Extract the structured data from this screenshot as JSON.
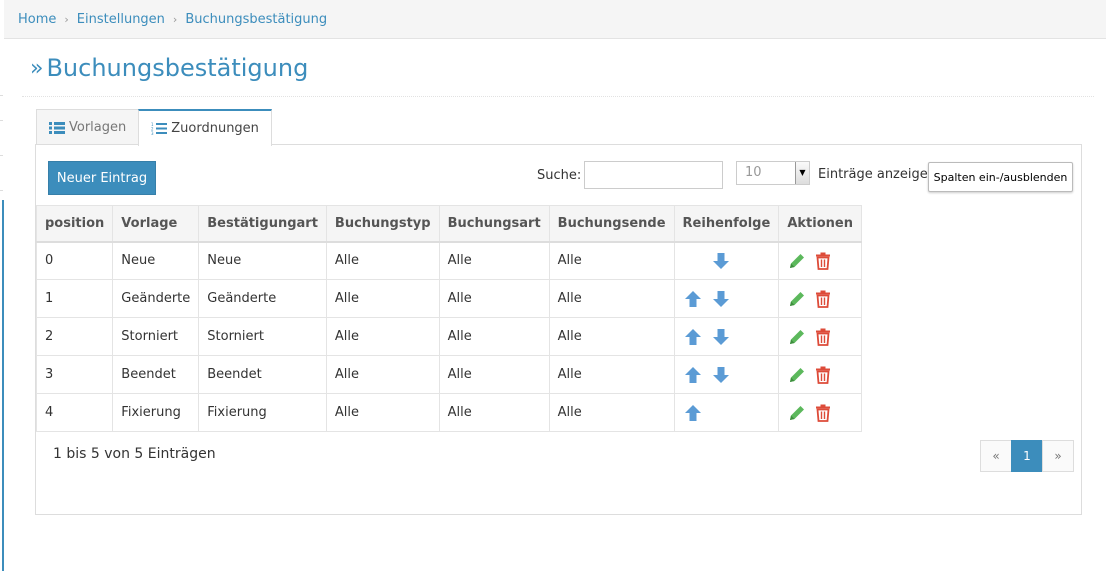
{
  "breadcrumb": [
    {
      "label": "Home"
    },
    {
      "label": "Einstellungen"
    },
    {
      "label": "Buchungsbestätigung"
    }
  ],
  "page": {
    "title": "Buchungsbestätigung"
  },
  "tabs": [
    {
      "label": "Vorlagen",
      "active": false
    },
    {
      "label": "Zuordnungen",
      "active": true
    }
  ],
  "toolbar": {
    "new_label": "Neuer Eintrag",
    "search_label": "Suche:",
    "search_value": "",
    "length_value": "10",
    "length_label": "Einträge anzeigen",
    "columns_label": "Spalten ein-/ausblenden"
  },
  "table": {
    "headers": [
      "position",
      "Vorlage",
      "Bestätigungart",
      "Buchungstyp",
      "Buchungsart",
      "Buchungsende",
      "Reihenfolge",
      "Aktionen"
    ],
    "rows": [
      {
        "position": "0",
        "vorlage": "Neue",
        "bestaetigungart": "Neue",
        "buchungstyp": "Alle",
        "buchungsart": "Alle",
        "buchungsende": "Alle",
        "up": false,
        "down": true
      },
      {
        "position": "1",
        "vorlage": "Geänderte",
        "bestaetigungart": "Geänderte",
        "buchungstyp": "Alle",
        "buchungsart": "Alle",
        "buchungsende": "Alle",
        "up": true,
        "down": true
      },
      {
        "position": "2",
        "vorlage": "Storniert",
        "bestaetigungart": "Storniert",
        "buchungstyp": "Alle",
        "buchungsart": "Alle",
        "buchungsende": "Alle",
        "up": true,
        "down": true
      },
      {
        "position": "3",
        "vorlage": "Beendet",
        "bestaetigungart": "Beendet",
        "buchungstyp": "Alle",
        "buchungsart": "Alle",
        "buchungsende": "Alle",
        "up": true,
        "down": true
      },
      {
        "position": "4",
        "vorlage": "Fixierung",
        "bestaetigungart": "Fixierung",
        "buchungstyp": "Alle",
        "buchungsart": "Alle",
        "buchungsende": "Alle",
        "up": true,
        "down": false
      }
    ]
  },
  "footer": {
    "info": "1 bis 5 von 5 Einträgen",
    "pager": {
      "prev": "«",
      "current": "1",
      "next": "»"
    }
  },
  "icons": {
    "arrow_up": "arrow-up-icon",
    "arrow_down": "arrow-down-icon",
    "edit": "pencil-icon",
    "delete": "trash-icon",
    "list": "list-icon",
    "ordered_list": "ordered-list-icon"
  },
  "colors": {
    "accent": "#3c8dbc",
    "edit": "#5cb85c",
    "delete": "#dd4b39"
  }
}
